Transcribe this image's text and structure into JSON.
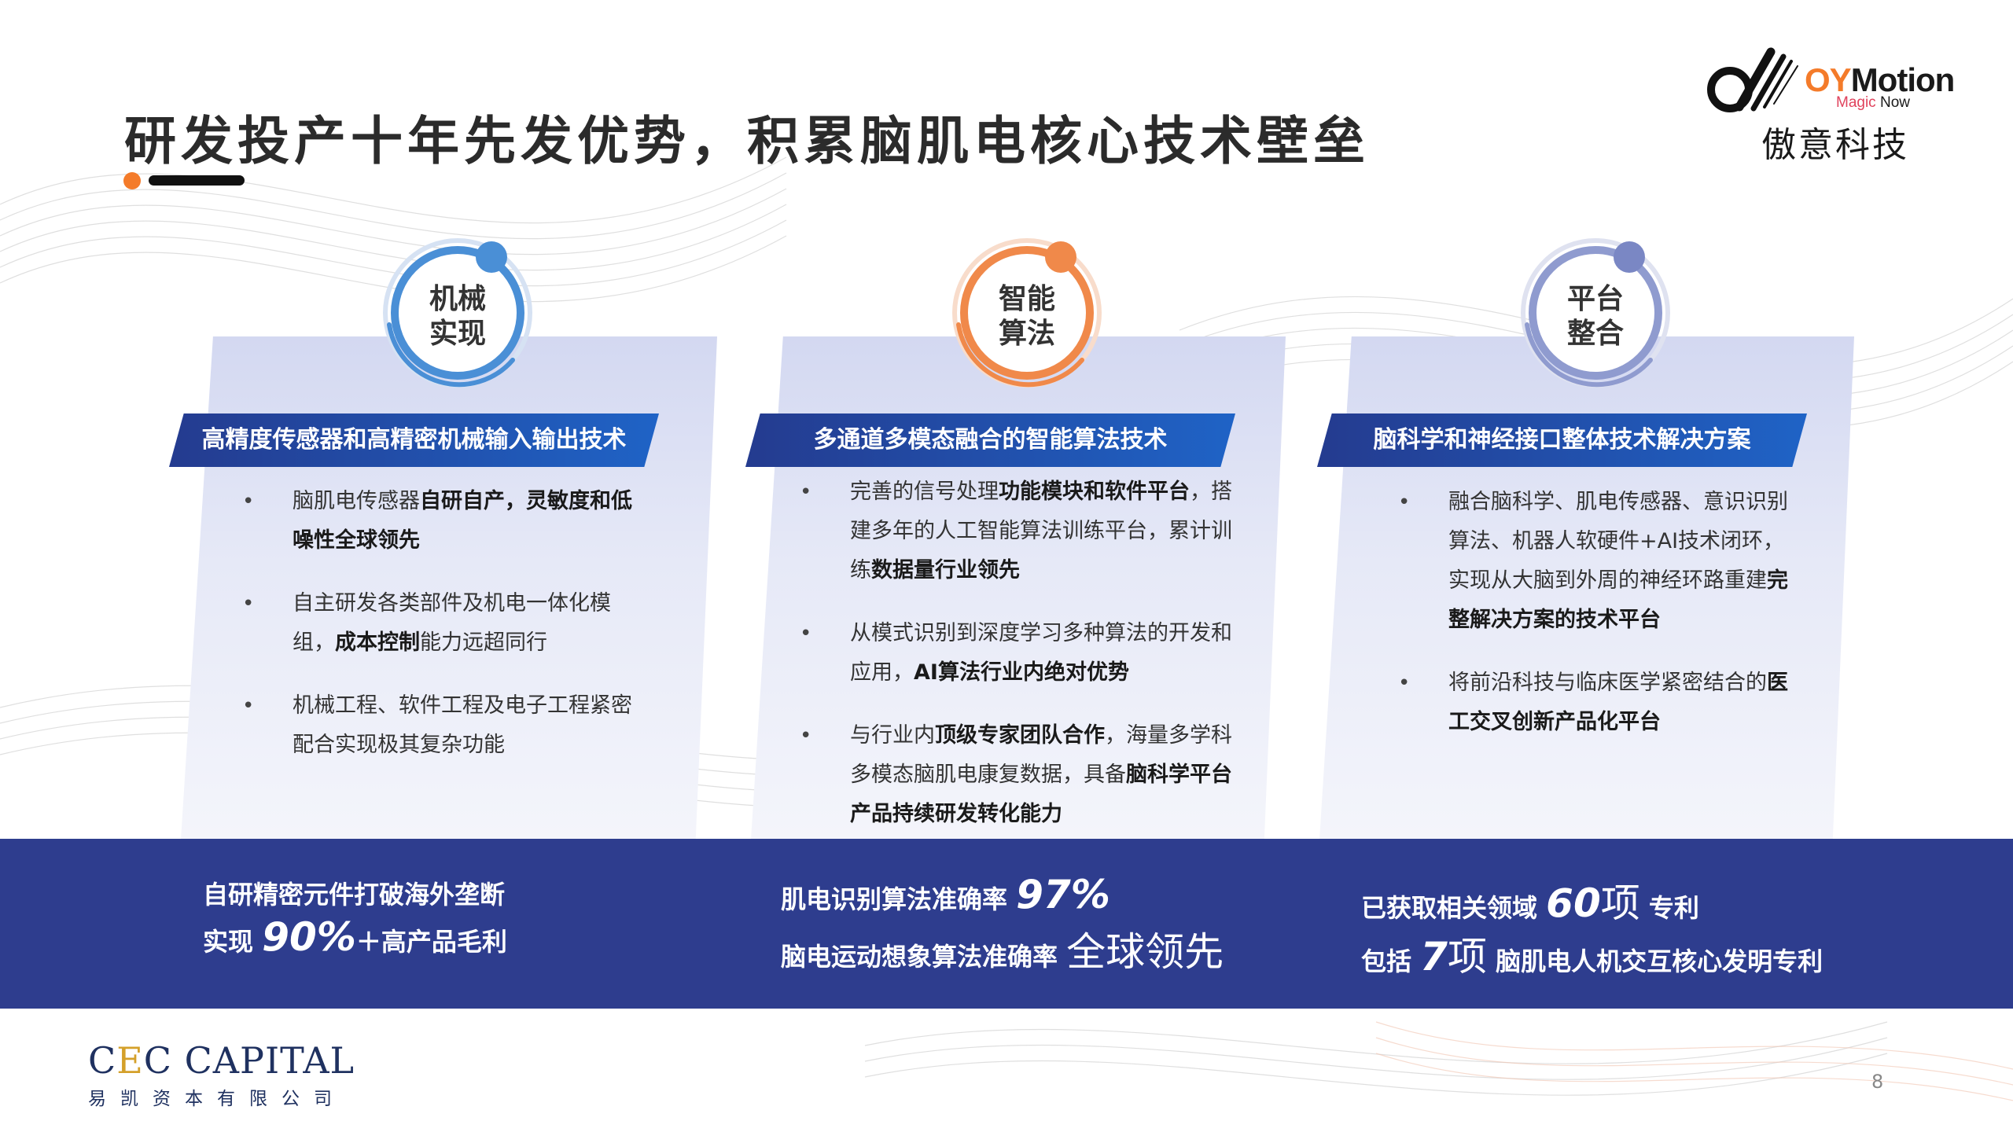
{
  "title": "研发投产十年先发优势，积累脑肌电核心技术壁垒",
  "logo": {
    "wordmark_oy": "OY",
    "wordmark_rest": "Motion",
    "tagline_magic": "Magic",
    "tagline_now": " Now",
    "chinese_name": "傲意科技"
  },
  "columns": [
    {
      "category_line1": "机械",
      "category_line2": "实现",
      "ring_color": "#4a8fd6",
      "ribbon": "高精度传感器和高精密机械输入输出技术",
      "bullets": [
        {
          "parts": [
            {
              "t": "脑肌电传感器"
            },
            {
              "t": "自研自产，灵敏度和低噪性全球领先",
              "bold": true
            }
          ]
        },
        {
          "parts": [
            {
              "t": "自主研发各类部件及机电一体化模组，"
            },
            {
              "t": "成本控制",
              "bold": true
            },
            {
              "t": "能力远超同行"
            }
          ]
        },
        {
          "parts": [
            {
              "t": "机械工程、软件工程及电子工程紧密配合实现极其复杂功能"
            }
          ]
        }
      ]
    },
    {
      "category_line1": "智能",
      "category_line2": "算法",
      "ring_color": "#f0894a",
      "ribbon": "多通道多模态融合的智能算法技术",
      "bullets": [
        {
          "parts": [
            {
              "t": "完善的信号处理"
            },
            {
              "t": "功能模块和软件平台",
              "bold": true
            },
            {
              "t": "，搭建多年的人工智能算法训练平台，累计训练"
            },
            {
              "t": "数据量行业领先",
              "bold": true
            }
          ]
        },
        {
          "parts": [
            {
              "t": "从模式识别到深度学习多种算法的开发和应用，"
            },
            {
              "t": "AI算法行业内绝对优势",
              "bold": true
            }
          ]
        },
        {
          "parts": [
            {
              "t": "与行业内"
            },
            {
              "t": "顶级专家团队合作",
              "bold": true
            },
            {
              "t": "，海量多学科多模态脑肌电康复数据，具备"
            },
            {
              "t": "脑科学平台产品持续研发转化能力",
              "bold": true
            }
          ]
        }
      ]
    },
    {
      "category_line1": "平台",
      "category_line2": "整合",
      "ring_color": "#8f9bcf",
      "ribbon": "脑科学和神经接口整体技术解决方案",
      "bullets": [
        {
          "parts": [
            {
              "t": "融合脑科学、肌电传感器、意识识别算法、机器人软硬件+AI技术闭环，实现从大脑到外周的神经环路重建"
            },
            {
              "t": "完整解决方案的技术平台",
              "bold": true
            }
          ]
        },
        {
          "parts": [
            {
              "t": "将前沿科技与临床医学紧密结合的"
            },
            {
              "t": "医工交叉创新产品化平台",
              "bold": true
            }
          ]
        }
      ]
    }
  ],
  "band": {
    "col1": {
      "line1": "自研精密元件打破海外垄断",
      "line2_a": "实现 ",
      "line2_big": "90%",
      "line2_b": "＋高产品毛利"
    },
    "col2": {
      "line1_a": "肌电识别算法准确率 ",
      "line1_big": "97%",
      "line2_a": "脑电运动想象算法准确率 ",
      "line2_thin": "全球领先"
    },
    "col3": {
      "line1_a": "已获取相关领域 ",
      "line1_big": "60",
      "line1_thin": "项",
      "line1_b": " 专利",
      "line2_a": "包括 ",
      "line2_big": "7",
      "line2_thin": "项",
      "line2_b": " 脑肌电人机交互核心发明专利"
    }
  },
  "footer": {
    "cec_c1": "C",
    "cec_e": "E",
    "cec_rest": "C CAPITAL",
    "cec_chinese": "易凯资本有限公司",
    "page_number": "8"
  },
  "colors": {
    "band": "#2e3d8e",
    "ribbon_start": "#243b8f",
    "ribbon_end": "#1f63c6",
    "accent_orange": "#f47b2a"
  }
}
